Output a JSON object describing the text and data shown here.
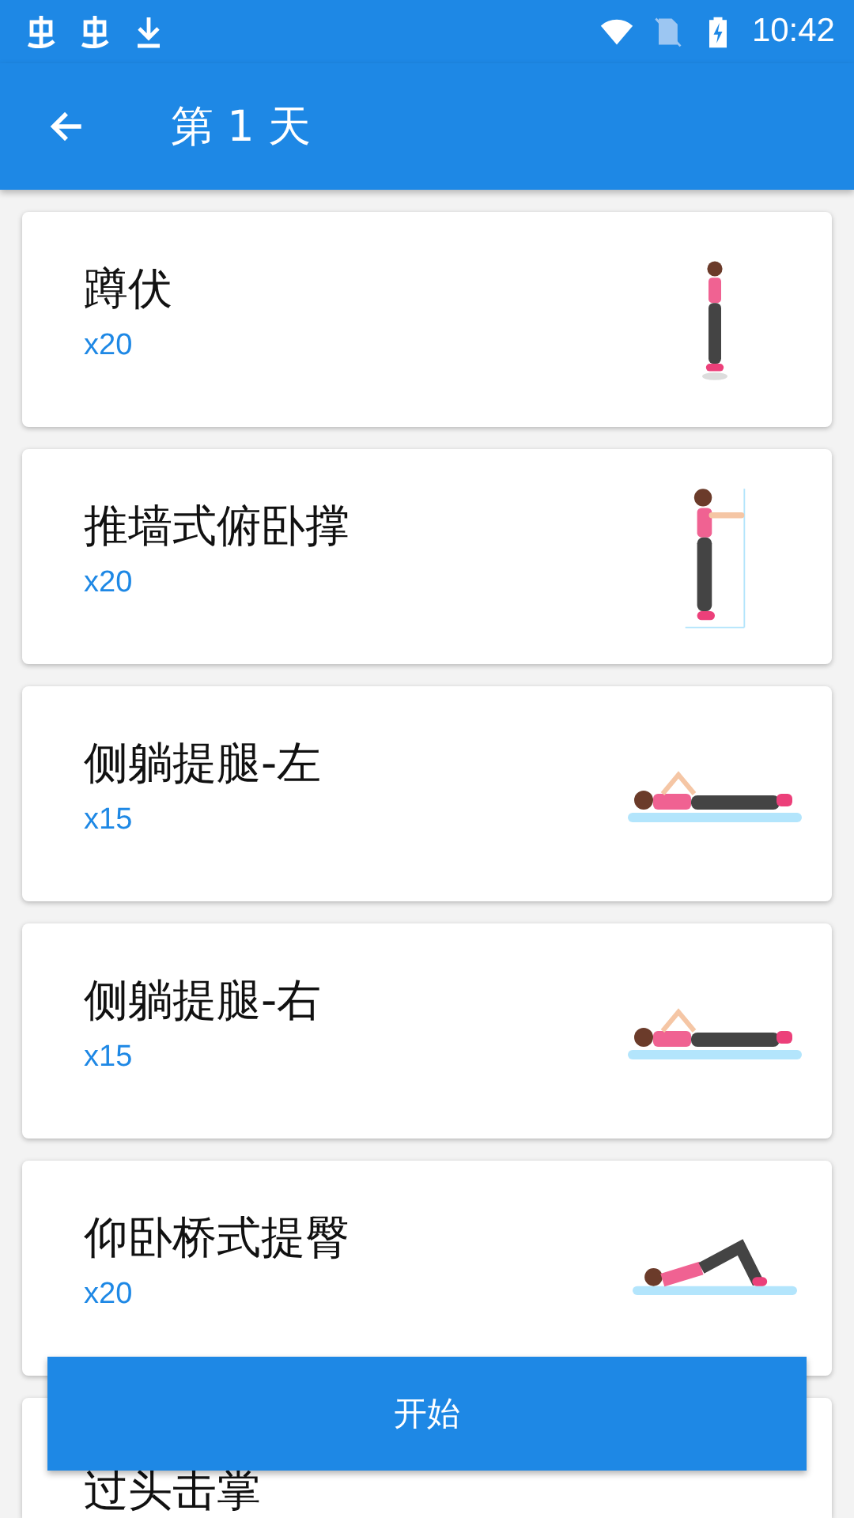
{
  "status_bar": {
    "time": "10:42"
  },
  "app_bar": {
    "title": "第 1 天"
  },
  "exercises": [
    {
      "name": "蹲伏",
      "count": "x20",
      "kind": "standing"
    },
    {
      "name": "推墙式俯卧撑",
      "count": "x20",
      "kind": "wall"
    },
    {
      "name": "侧躺提腿-左",
      "count": "x15",
      "kind": "lying"
    },
    {
      "name": "侧躺提腿-右",
      "count": "x15",
      "kind": "lying"
    },
    {
      "name": "仰卧桥式提臀",
      "count": "x20",
      "kind": "bridge"
    },
    {
      "name": "过头击掌",
      "kind": "partial"
    }
  ],
  "start_button": {
    "label": "开始"
  }
}
